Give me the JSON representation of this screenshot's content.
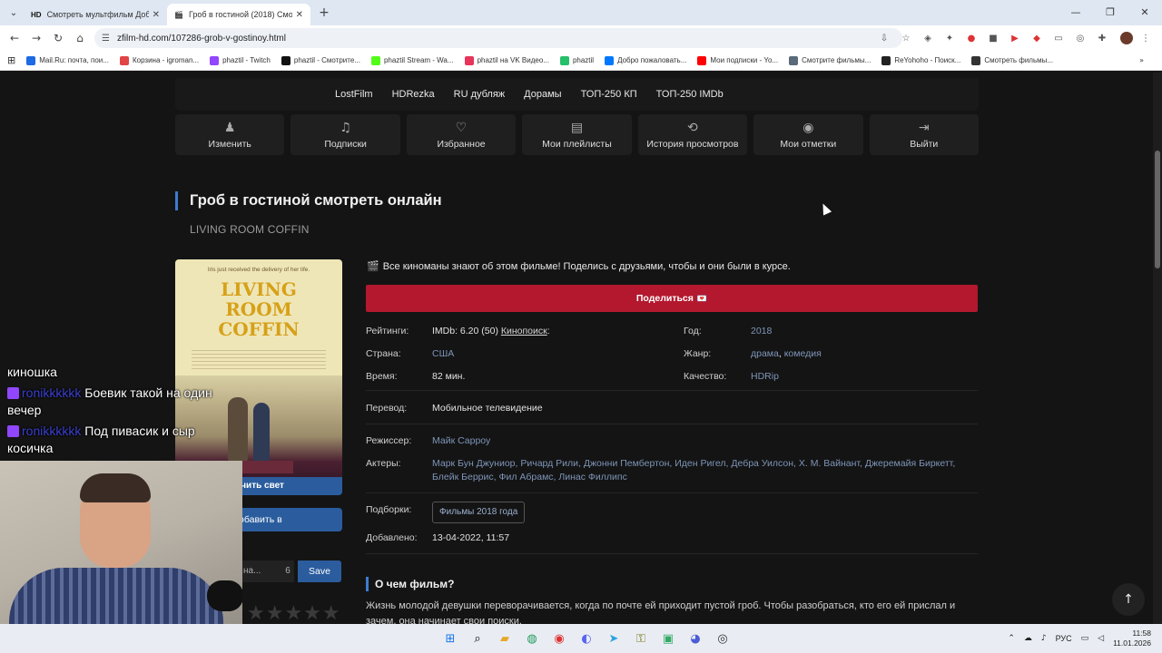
{
  "browser": {
    "tabs": [
      {
        "favicon": "HD",
        "title": "Смотреть мультфильм Добры",
        "active": false
      },
      {
        "favicon": "",
        "title": "Гроб в гостиной (2018) Смотр",
        "active": true
      }
    ],
    "new_tab": "+",
    "url": "zfilm-hd.com/107286-grob-v-gostinoy.html",
    "bookmarks": [
      {
        "label": "Mail.Ru: почта, пои...",
        "color": "#1d6ae5"
      },
      {
        "label": "Корзина - igroman...",
        "color": "#e04444"
      },
      {
        "label": "phaztil - Twitch",
        "color": "#9146ff"
      },
      {
        "label": "phaztil - Смотрите...",
        "color": "#111111"
      },
      {
        "label": "phaztil Stream - Wa...",
        "color": "#53fc18"
      },
      {
        "label": "phaztil на VK Видео...",
        "color": "#e8335a"
      },
      {
        "label": "phaztil",
        "color": "#27c06a"
      },
      {
        "label": "Добро пожаловать...",
        "color": "#0077ff"
      },
      {
        "label": "Мои подписки - Yo...",
        "color": "#ff0000"
      },
      {
        "label": "Смотрите фильмы...",
        "color": "#5a6a7a"
      },
      {
        "label": "ReYohoho - Поиск...",
        "color": "#222222"
      },
      {
        "label": "Смотреть фильмы...",
        "color": "#333333"
      }
    ]
  },
  "site": {
    "topnav": [
      "LostFilm",
      "HDRezka",
      "RU дубляж",
      "Дорамы",
      "ТОП-250 КП",
      "ТОП-250 IMDb"
    ],
    "userbar": [
      {
        "label": "Изменить",
        "icon": "user-icon"
      },
      {
        "label": "Подписки",
        "icon": "bell-icon"
      },
      {
        "label": "Избранное",
        "icon": "heart-icon"
      },
      {
        "label": "Мои плейлисты",
        "icon": "document-icon"
      },
      {
        "label": "История просмотров",
        "icon": "history-icon"
      },
      {
        "label": "Мои отметки",
        "icon": "play-circle-icon"
      },
      {
        "label": "Выйти",
        "icon": "logout-icon"
      }
    ]
  },
  "movie": {
    "title": "Гроб в гостиной смотреть онлайн",
    "original_title": "LIVING ROOM COFFIN",
    "poster": {
      "tagline": "Iris just received the delivery of her life.",
      "title_lines": [
        "LIVING",
        "ROOM",
        "COFFIN"
      ]
    },
    "buttons": {
      "light": "ючить свет",
      "add": "обавить в",
      "note_placeholder": "ь на...",
      "note_count": "6",
      "save": "Save"
    },
    "stars": "★★★★★",
    "promo": "Все киноманы знают об этом фильме! Поделись с друзьями, чтобы и они были в курсе.",
    "share": "Поделиться",
    "labels": {
      "ratings": "Рейтинги:",
      "year": "Год:",
      "country": "Страна:",
      "genre": "Жанр:",
      "time": "Время:",
      "quality": "Качество:",
      "translation": "Перевод:",
      "director": "Режиссер:",
      "actors": "Актеры:",
      "collections": "Подборки:",
      "added": "Добавлено:"
    },
    "imdb": "IMDb: 6.20 (50)",
    "kinopoisk": "Кинопоиск",
    "kinopoisk_suffix": ":",
    "year": "2018",
    "country": "США",
    "genres": [
      "драма",
      "комедия"
    ],
    "genre_sep": ", ",
    "time": "82 мин.",
    "quality": "HDRip",
    "translation": "Мобильное телевидение",
    "director": "Майк Сарроу",
    "actors_line1": "Марк Бун Джуниор, Ричард Рили, Джонни Пембертон, Иден Ригел, Дебра Уилсон, Х. М. Вайнант, Джеремайя Биркетт,",
    "actors_line2": "Блейк Беррис, Фил Абрамс, Линас Филлипс",
    "collection": "Фильмы 2018 года",
    "added": "13-04-2022, 11:57",
    "about_heading": "О чем фильм?",
    "about_text": "Жизнь молодой девушки переворачивается, когда по почте ей приходит пустой гроб. Чтобы разобраться, кто его ей прислал и зачем, она начинает свои поиски."
  },
  "stream": {
    "chat": [
      {
        "user": "",
        "text": "киношка"
      },
      {
        "user": "ronikkkkkk",
        "text": "Боевик такой на один вечер"
      },
      {
        "user": "ronikkkkkk",
        "text": "Под пивасик и сыр косичка"
      }
    ]
  },
  "taskbar": {
    "lang": "РУС",
    "time": "11:58",
    "date": "11.01.2026"
  },
  "colors": {
    "accent": "#3d7bd1",
    "share": "#b3182e",
    "link": "#7e95b8",
    "bg": "#141414"
  }
}
